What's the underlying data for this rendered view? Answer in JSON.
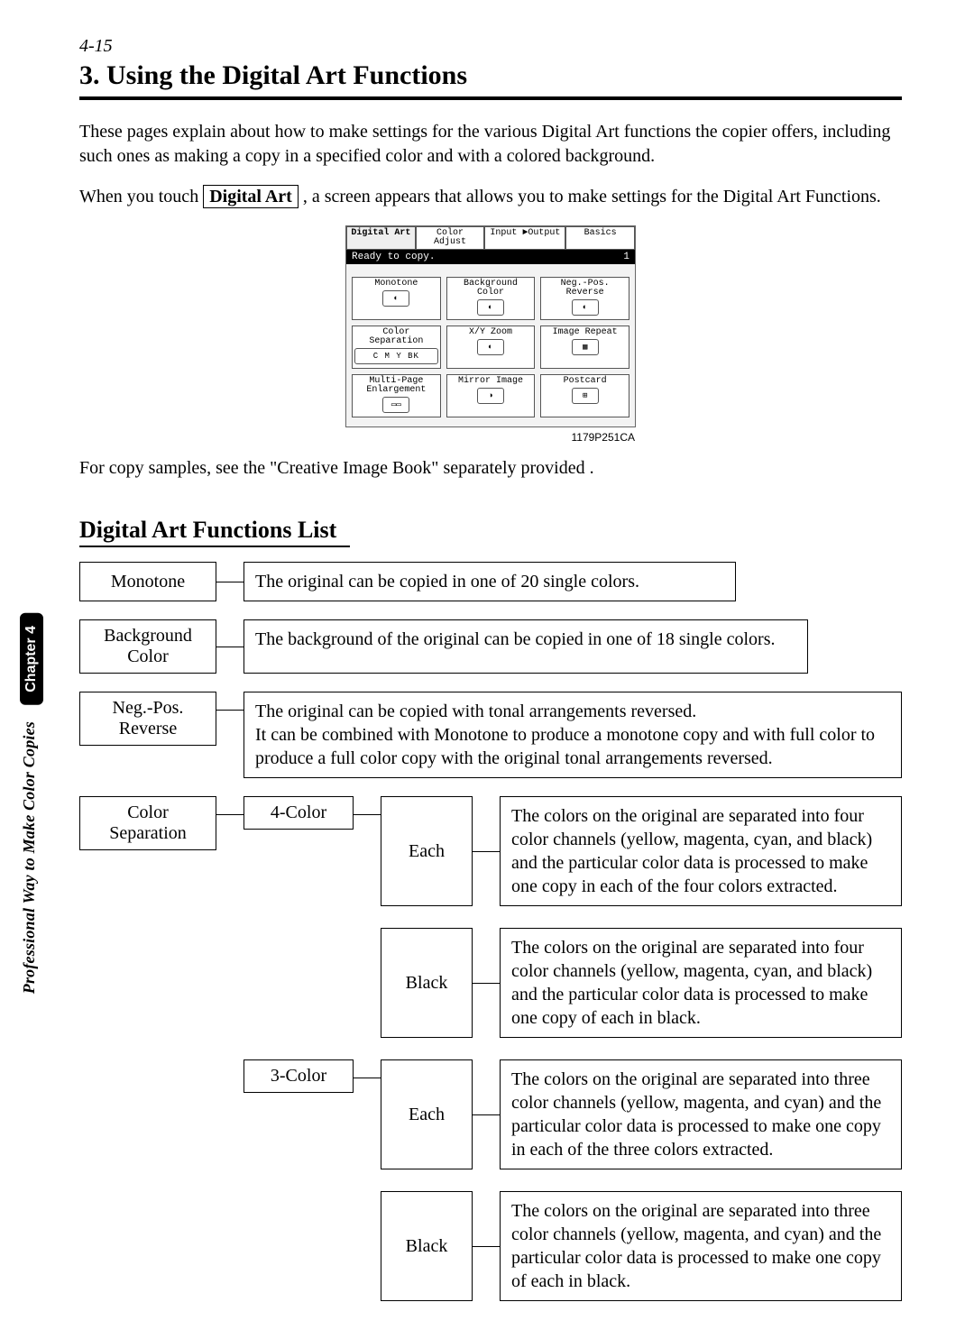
{
  "header": {
    "page_ref": "4-15",
    "title": "3. Using the Digital Art Functions"
  },
  "intro": {
    "p1": "These pages explain about how to make settings for the various Digital Art functions the copier offers, including such ones as making a copy in a specified color and with a colored background.",
    "p2a": "When you touch ",
    "button_label": "Digital Art",
    "p2b": " , a screen appears that allows you to make settings for the Digital Art Functions."
  },
  "screen": {
    "tabs": [
      "Digital Art",
      "Color Adjust",
      "Input ►Output",
      "Basics"
    ],
    "status_text": "Ready to copy.",
    "status_count": "1",
    "cells": [
      "Monotone",
      "Background Color",
      "Neg.-Pos. Reverse",
      "Color Separation",
      "X/Y Zoom",
      "Image Repeat",
      "Multi-Page Enlargement",
      "Mirror Image",
      "Postcard"
    ],
    "sep_letters": [
      "C",
      "M",
      "Y",
      "BK"
    ]
  },
  "figure_code": "1179P251CA",
  "after_fig": "For copy samples, see the \"Creative Image Book\" separately provided .",
  "side": {
    "chapter": "Chapter 4",
    "caption": "Professional Way to Make Color Copies"
  },
  "list_heading": "Digital Art Functions List",
  "funcs": {
    "monotone": {
      "label": "Monotone",
      "desc": "The original can be copied in one of 20 single colors."
    },
    "bgcolor": {
      "label_l1": "Background",
      "label_l2": "Color",
      "desc": "The background of the original can be copied in one of 18 single colors."
    },
    "negpos": {
      "label_l1": "Neg.-Pos.",
      "label_l2": "Reverse",
      "desc": "The original can be copied with tonal arrangements reversed.\nIt can be combined with Monotone to produce a monotone copy and with full color to produce a full color copy with the original tonal arrangements reversed."
    },
    "colorsep": {
      "label_l1": "Color",
      "label_l2": "Separation",
      "four": {
        "label": "4-Color",
        "each": {
          "label": "Each",
          "desc": "The colors on the original are separated into four color channels (yellow, magenta, cyan, and black) and the particular color data is processed to make one copy in each of the four colors extracted."
        },
        "black": {
          "label": "Black",
          "desc": "The colors on the original are separated into four color channels (yellow, magenta, cyan, and black) and the particular color data is processed to make one copy of each in black."
        }
      },
      "three": {
        "label": "3-Color",
        "each": {
          "label": "Each",
          "desc": "The colors on the original are separated into three color channels (yellow, magenta, and cyan) and the particular color data is processed to make one copy in each of the three colors extracted."
        },
        "black": {
          "label": "Black",
          "desc": "The colors on the original are separated into three color channels (yellow, magenta, and cyan) and the particular color data is processed to make one copy of each in black."
        }
      }
    }
  }
}
